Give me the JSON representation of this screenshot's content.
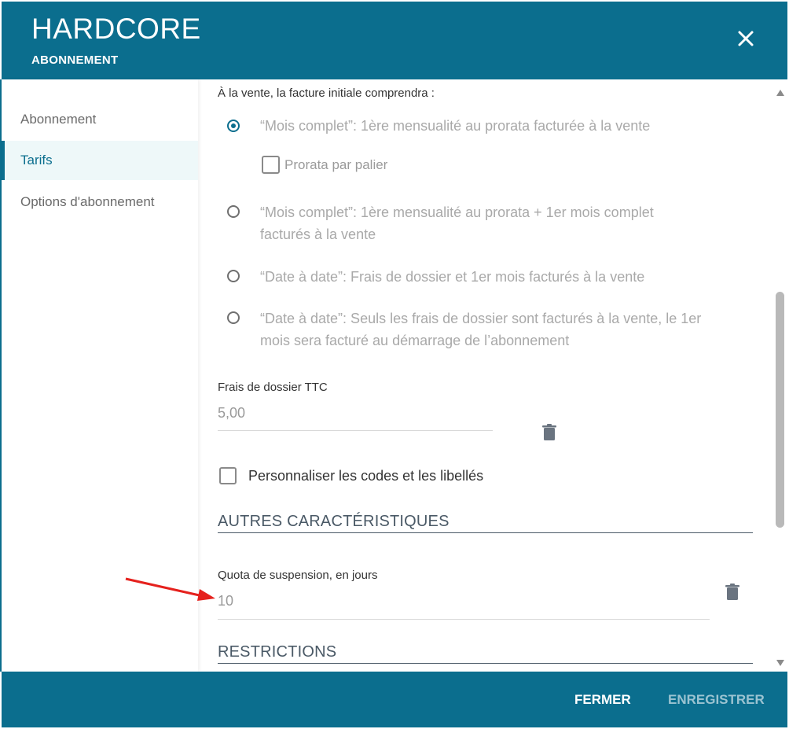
{
  "header": {
    "title": "HARDCORE",
    "subtitle": "ABONNEMENT"
  },
  "sidebar": {
    "items": [
      {
        "label": "Abonnement"
      },
      {
        "label": "Tarifs"
      },
      {
        "label": "Options d'abonnement"
      }
    ],
    "active_index": 1
  },
  "invoice": {
    "intro": "À la vente, la facture initiale comprendra :",
    "options": [
      {
        "label": "“Mois complet”: 1ère mensualité au prorata facturée à la vente",
        "checked": true
      },
      {
        "label_line1": "“Mois complet”: 1ère mensualité au prorata + 1er mois complet",
        "label_line2": "facturés à la vente",
        "checked": false
      },
      {
        "label": "“Date à date”: Frais de dossier et 1er mois facturés à la vente",
        "checked": false
      },
      {
        "label_line1": "“Date à date”: Seuls les frais de dossier sont facturés à la vente, le 1er",
        "label_line2": "mois sera facturé au démarrage de l’abonnement",
        "checked": false
      }
    ],
    "prorata_checkbox_label": "Prorata par palier"
  },
  "fees": {
    "label": "Frais de dossier TTC",
    "value": "5,00"
  },
  "customize": {
    "label": "Personnaliser les codes et les libellés"
  },
  "sections": {
    "other": "AUTRES CARACTÉRISTIQUES",
    "restrictions": "RESTRICTIONS"
  },
  "quota": {
    "label": "Quota de suspension, en jours",
    "value": "10"
  },
  "footer": {
    "close_label": "FERMER",
    "save_label": "ENREGISTRER"
  },
  "colors": {
    "primary": "#0b6e8e",
    "annotation_arrow": "#e5211d"
  },
  "icons": {
    "close": "close-icon",
    "trash": "trash-icon",
    "arrow": "annotation-arrow"
  }
}
